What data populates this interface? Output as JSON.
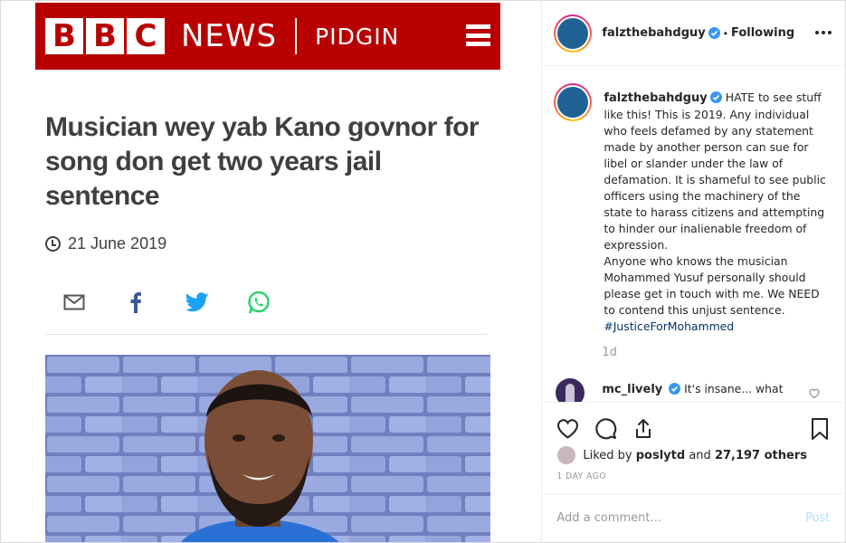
{
  "media": {
    "brand": {
      "letters": [
        "B",
        "B",
        "C"
      ],
      "news": "NEWS",
      "section": "PIDGIN"
    },
    "headline": "Musician wey yab Kano govnor for song don get two years jail sentence",
    "date": "21 June 2019",
    "share_icons": [
      "email-icon",
      "facebook-icon",
      "twitter-icon",
      "whatsapp-icon"
    ]
  },
  "post": {
    "username": "falzthebahdguy",
    "follow_status": "Following",
    "caption": {
      "username": "falzthebahdguy",
      "text": "HATE to see stuff like this! This is 2019. Any individual who feels defamed by any statement made by another person can sue for libel or slander under the law of defamation. It is shameful to see public officers using the machinery of the state to harass citizens and attempting to hinder our inalienable freedom of expression.",
      "text2": "Anyone who knows the musician Mohammed Yusuf personally should please get in touch with me. We NEED to contend this unjust sentence.",
      "hashtag": "#JusticeForMohammed",
      "age": "1d"
    },
    "comment": {
      "username": "mc_lively",
      "text": "It's insane... what"
    },
    "likes": {
      "prefix": "Liked by",
      "user": "poslytd",
      "connector": "and",
      "count": "27,197 others"
    },
    "post_date": "1 DAY AGO",
    "add_comment_placeholder": "Add a comment...",
    "post_button": "Post"
  },
  "colors": {
    "bbc_red": "#b80000",
    "link_blue": "#003569",
    "verified_blue": "#3897f0",
    "muted": "#999999"
  }
}
